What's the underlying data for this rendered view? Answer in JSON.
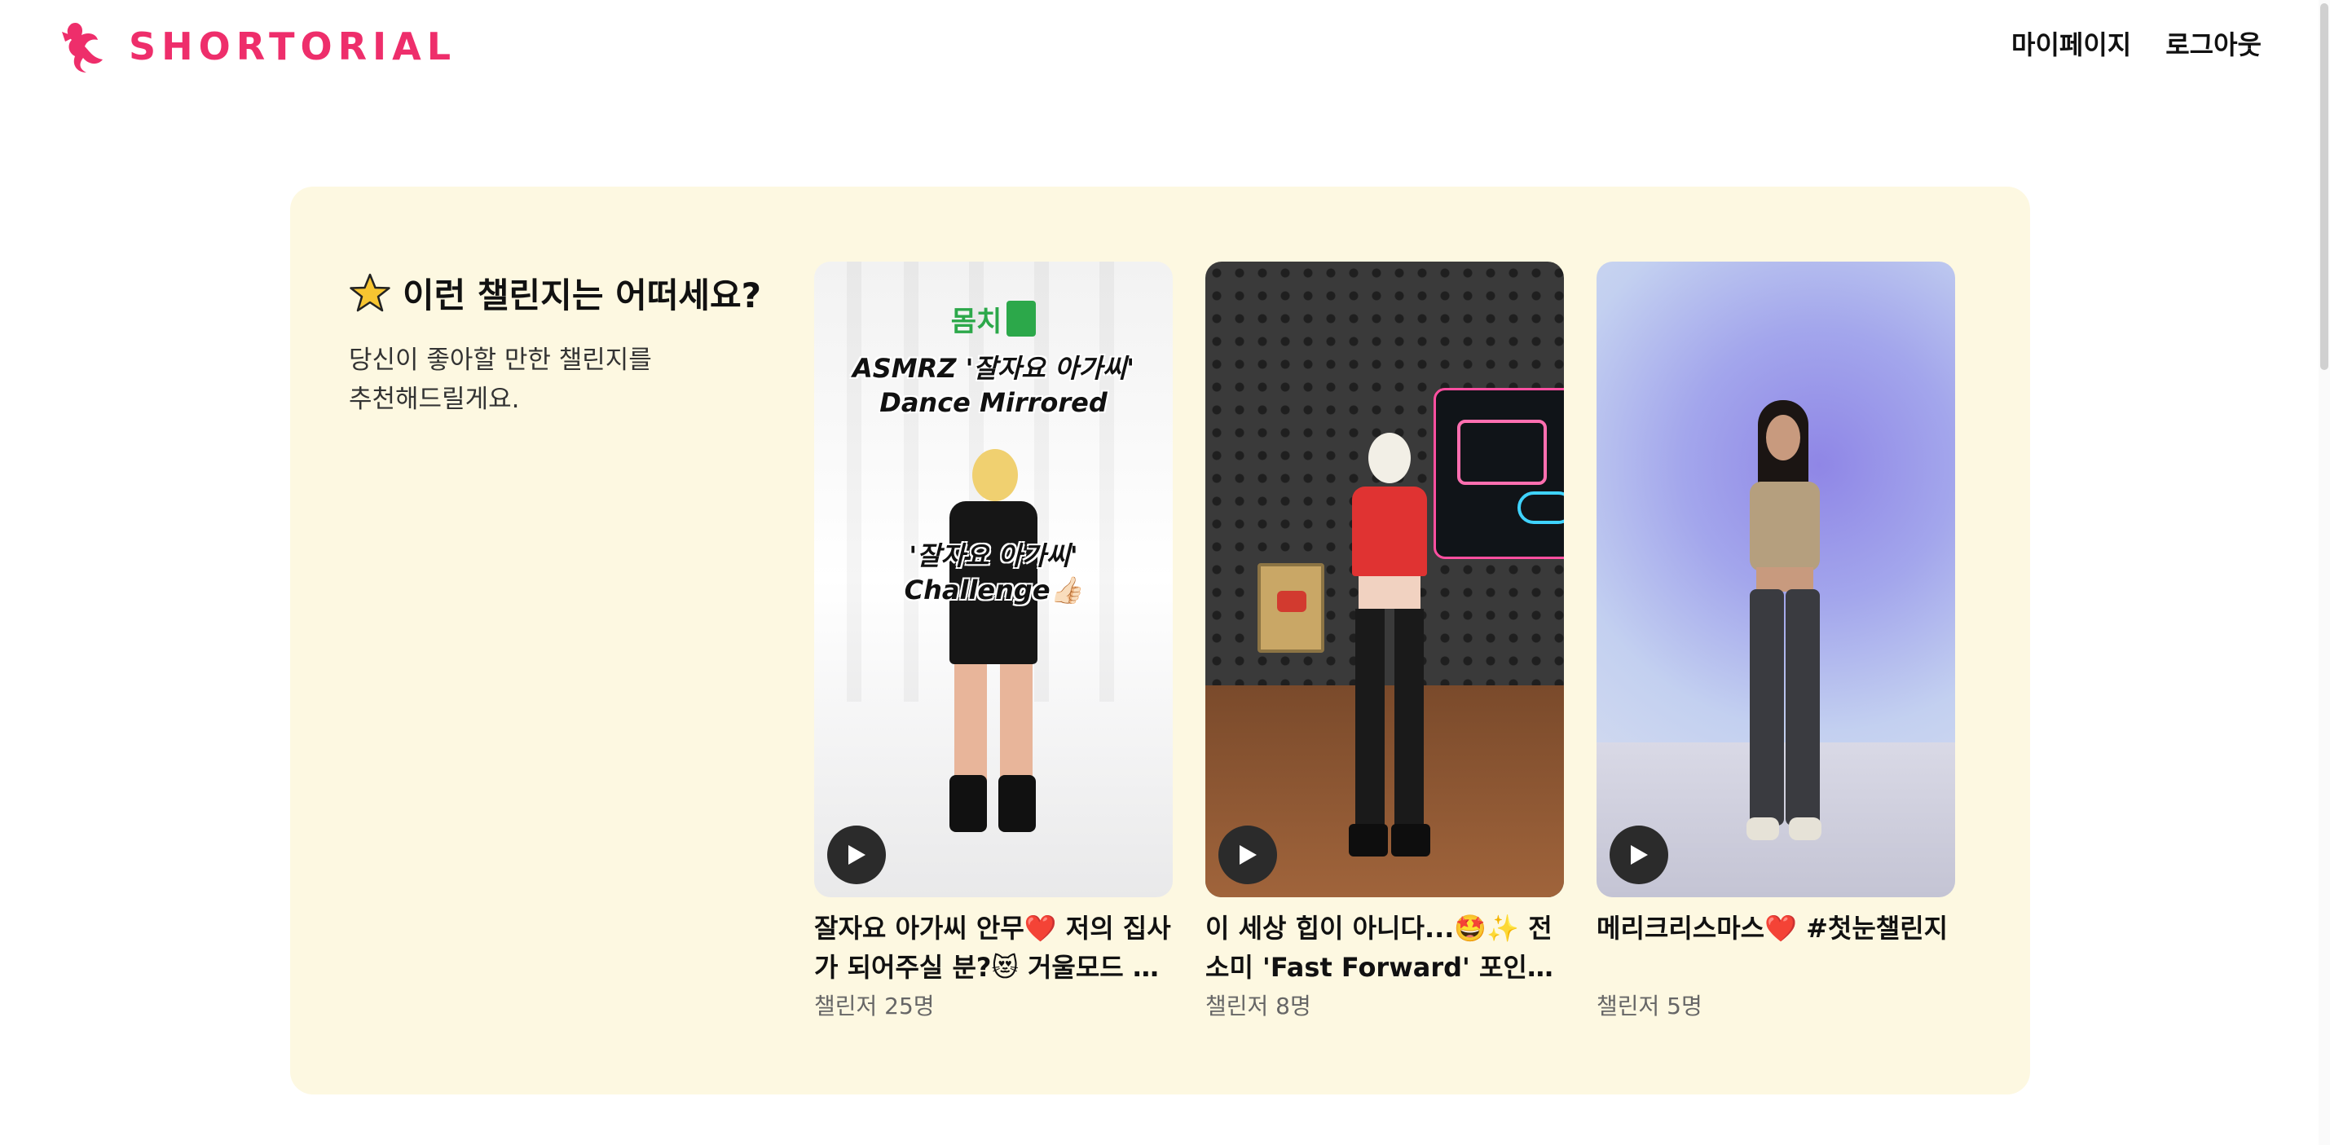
{
  "brand": {
    "name": "SHORTORIAL",
    "color": "#ee2e6b"
  },
  "nav": {
    "mypage": "마이페이지",
    "logout": "로그아웃"
  },
  "recommend": {
    "title": "이런 챌린지는 어떠세요?",
    "title_icon": "star-icon",
    "desc_line1": "당신이 좋아할 만한 챌린지를",
    "desc_line2": "추천해드릴게요.",
    "background": "#fdf8e1"
  },
  "cards": [
    {
      "title": "잘자요 아가씨 안무❤️ 저의 집사가 되어주실 분?😻 거울모드 안무",
      "challengers": "챌린저 25명",
      "overlay_top": "ASMRZ '잘자요 아가씨'",
      "overlay_top2": "Dance Mirrored",
      "overlay_mid": "'잘자요 아가씨'",
      "overlay_mid2": "Challenge👍🏻",
      "badge": "몸치"
    },
    {
      "title": "이 세상 힙이 아니다...🤩✨ 전소미 'Fast Forward' 포인트 안무",
      "challengers": "챌린저 8명"
    },
    {
      "title": "메리크리스마스❤️ #첫눈챌린지",
      "challengers": "챌린저 5명"
    }
  ]
}
